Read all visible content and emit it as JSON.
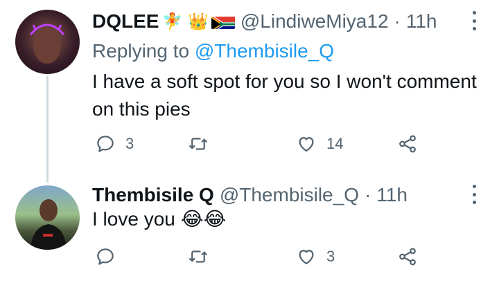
{
  "tweets": [
    {
      "display_name": "DQLEE",
      "name_emojis": "🧚 👑",
      "handle": "@LindiweMiya12",
      "separator": "·",
      "time": "11h",
      "replying_prefix": "Replying to",
      "replying_to": "@Thembisile_Q",
      "text": "I have a soft spot for you so I won't comment on this pies",
      "actions": {
        "reply_count": "3",
        "retweet_count": "",
        "like_count": "14"
      }
    },
    {
      "display_name": "Thembisile Q",
      "handle": "@Thembisile_Q",
      "separator": "·",
      "time": "11h",
      "text": "I love you",
      "text_emojis": "😂😂",
      "actions": {
        "reply_count": "",
        "retweet_count": "",
        "like_count": "3"
      }
    }
  ],
  "icons": [
    "more-icon",
    "reply-icon",
    "retweet-icon",
    "like-icon",
    "share-icon",
    "crown-emoji",
    "fairy-emoji",
    "south-africa-flag",
    "laughing-emoji"
  ],
  "colors": {
    "link": "#1d9bf0",
    "muted": "#536471",
    "text": "#0f1419",
    "thread_line": "#cfd9de"
  }
}
